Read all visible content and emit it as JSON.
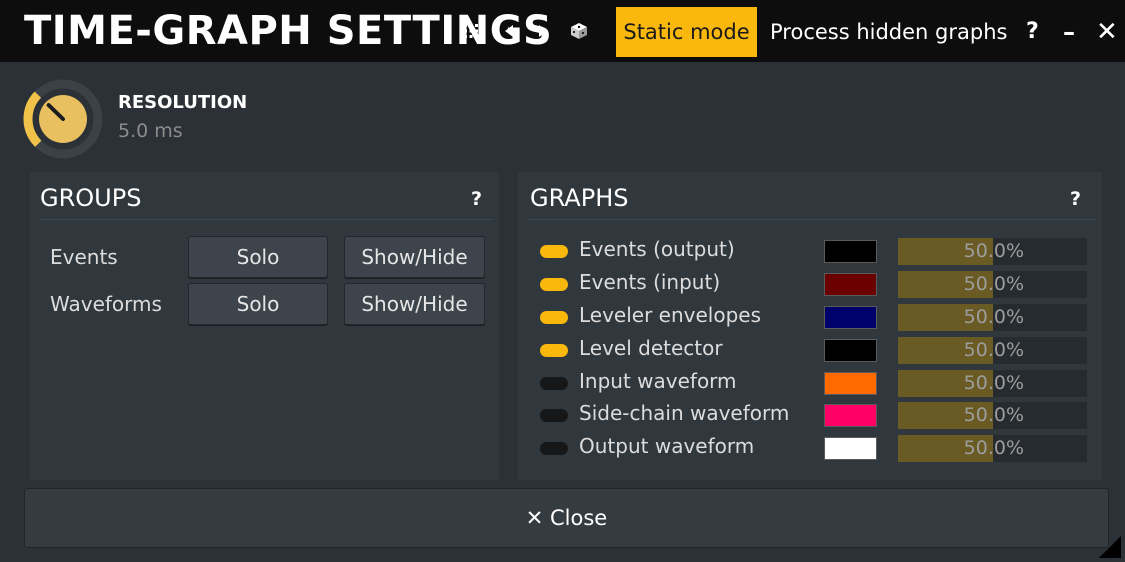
{
  "titlebar": {
    "title": "TIME-GRAPH SETTINGS",
    "static_mode_label": "Static mode",
    "process_hidden_label": "Process hidden graphs",
    "help_label": "?",
    "minimize_label": "–",
    "close_label": "✕",
    "menu_icon": "grid-menu-icon",
    "prev_icon": "triangle-left-icon",
    "next_icon": "triangle-right-icon",
    "random_icon": "dice-icon",
    "accent_color": "#fbb80c"
  },
  "resolution": {
    "label": "RESOLUTION",
    "value": "5.0 ms",
    "knob_icon": "knob-icon",
    "knob_level": 0.33
  },
  "groups": {
    "title": "GROUPS",
    "help_label": "?",
    "rows": [
      {
        "label": "Events",
        "solo_label": "Solo",
        "showhide_label": "Show/Hide"
      },
      {
        "label": "Waveforms",
        "solo_label": "Solo",
        "showhide_label": "Show/Hide"
      }
    ]
  },
  "graphs": {
    "title": "GRAPHS",
    "help_label": "?",
    "rows": [
      {
        "name": "Events (output)",
        "enabled": true,
        "color": "#000000",
        "value": "50.0%",
        "fraction": 0.5
      },
      {
        "name": "Events (input)",
        "enabled": true,
        "color": "#6b0000",
        "value": "50.0%",
        "fraction": 0.5
      },
      {
        "name": "Leveler envelopes",
        "enabled": true,
        "color": "#00006b",
        "value": "50.0%",
        "fraction": 0.5
      },
      {
        "name": "Level detector",
        "enabled": true,
        "color": "#000000",
        "value": "50.0%",
        "fraction": 0.5
      },
      {
        "name": "Input waveform",
        "enabled": false,
        "color": "#ff6a00",
        "value": "50.0%",
        "fraction": 0.5
      },
      {
        "name": "Side-chain waveform",
        "enabled": false,
        "color": "#ff0066",
        "value": "50.0%",
        "fraction": 0.5
      },
      {
        "name": "Output waveform",
        "enabled": false,
        "color": "#ffffff",
        "value": "50.0%",
        "fraction": 0.5
      }
    ]
  },
  "footer": {
    "close_label": "✕ Close"
  }
}
